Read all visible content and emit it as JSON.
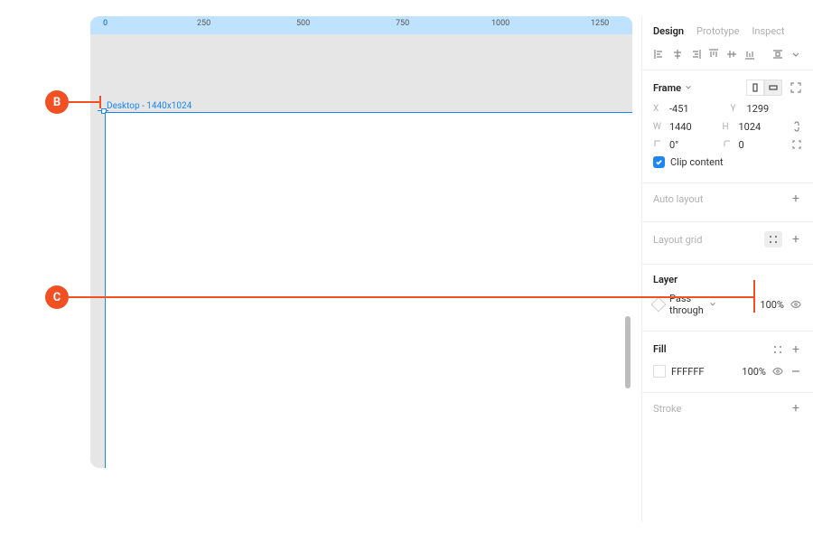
{
  "callouts": {
    "b": "B",
    "c": "C"
  },
  "ruler": {
    "origin": "0",
    "t1": "250",
    "t2": "500",
    "t3": "750",
    "t4": "1000",
    "t5": "1250"
  },
  "canvas": {
    "frame_label": "Desktop - 1440x1024"
  },
  "tabs": {
    "design": "Design",
    "prototype": "Prototype",
    "inspect": "Inspect"
  },
  "frame": {
    "title": "Frame",
    "x_label": "X",
    "x": "-451",
    "y_label": "Y",
    "y": "1299",
    "w_label": "W",
    "w": "1440",
    "h_label": "H",
    "h": "1024",
    "rot_label": "",
    "rot": "0°",
    "rad_label": "",
    "rad": "0",
    "clip": "Clip content"
  },
  "auto_layout": {
    "title": "Auto layout"
  },
  "layout_grid": {
    "title": "Layout grid"
  },
  "layer": {
    "title": "Layer",
    "blend": "Pass through",
    "opacity": "100%"
  },
  "fill": {
    "title": "Fill",
    "hex": "FFFFFF",
    "opacity": "100%"
  },
  "stroke": {
    "title": "Stroke"
  }
}
